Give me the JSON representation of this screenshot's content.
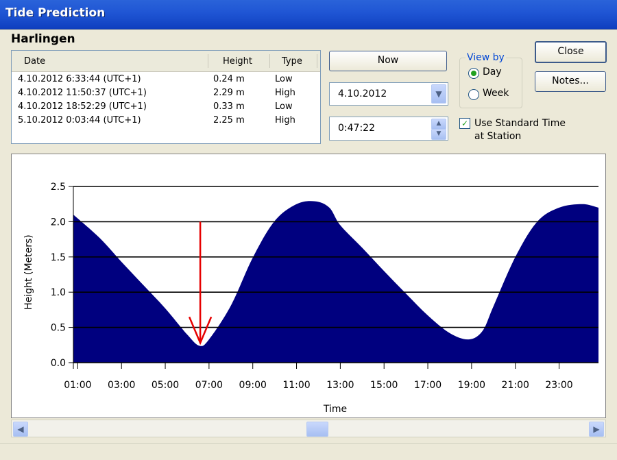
{
  "window": {
    "title": "Tide Prediction"
  },
  "station": "Harlingen",
  "table": {
    "columns": [
      "Date",
      "Height",
      "Type"
    ],
    "rows": [
      [
        "4.10.2012 6:33:44 (UTC+1)",
        "0.24 m",
        "Low"
      ],
      [
        "4.10.2012 11:50:37 (UTC+1)",
        "2.29 m",
        "High"
      ],
      [
        "4.10.2012 18:52:29 (UTC+1)",
        "0.33 m",
        "Low"
      ],
      [
        "5.10.2012 0:03:44 (UTC+1)",
        "2.25 m",
        "High"
      ]
    ]
  },
  "controls": {
    "now_label": "Now",
    "date_value": "4.10.2012",
    "time_value": "0:47:22",
    "view_by_label": "View by",
    "view_day_label": "Day",
    "view_week_label": "Week",
    "view_selected": "Day",
    "use_standard_time_line1": "Use Standard Time",
    "use_standard_time_line2": "at Station",
    "use_standard_time_checked": true,
    "close_label": "Close",
    "notes_label": "Notes..."
  },
  "colors": {
    "fill": "#00007f",
    "arrow": "#e60000",
    "title_bar": "#1f55d4",
    "group_label": "#0046d5"
  },
  "chart_data": {
    "type": "area",
    "ylabel": "Height (Meters)",
    "xlabel": "Time",
    "ylim": [
      0,
      2.5
    ],
    "y_ticks": [
      "0.0",
      "0.5",
      "1.0",
      "1.5",
      "2.0",
      "2.5"
    ],
    "x_ticks": [
      "01:00",
      "03:00",
      "05:00",
      "07:00",
      "09:00",
      "11:00",
      "13:00",
      "15:00",
      "17:00",
      "19:00",
      "21:00",
      "23:00"
    ],
    "x_hours": [
      0.8,
      24.8
    ],
    "series": [
      {
        "x": [
          0.8,
          2.0,
          3.0,
          4.0,
          5.0,
          6.0,
          6.56,
          7.0,
          8.0,
          9.0,
          10.0,
          11.0,
          11.84,
          12.5,
          13.0,
          14.0,
          15.0,
          16.0,
          17.0,
          18.0,
          18.87,
          19.5,
          20.0,
          21.0,
          22.0,
          23.0,
          24.06,
          24.8
        ],
        "y": [
          2.1,
          1.77,
          1.43,
          1.1,
          0.77,
          0.4,
          0.24,
          0.33,
          0.81,
          1.49,
          2.01,
          2.25,
          2.29,
          2.2,
          1.95,
          1.63,
          1.3,
          0.98,
          0.67,
          0.42,
          0.33,
          0.45,
          0.8,
          1.5,
          2.0,
          2.2,
          2.25,
          2.2
        ]
      }
    ],
    "grid": true,
    "marker": {
      "x": 6.6,
      "y_from": 2.0,
      "y_to": 0.28,
      "kind": "arrow"
    }
  }
}
